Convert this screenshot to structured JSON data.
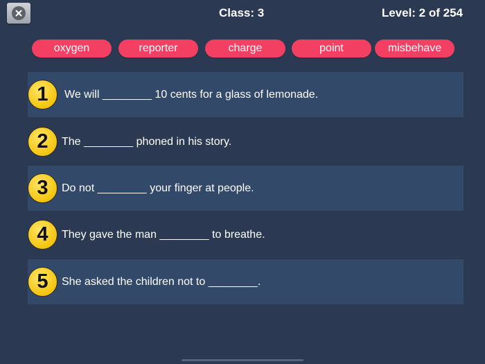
{
  "header": {
    "class_label": "Class: 3",
    "level_label": "Level: 2 of 254"
  },
  "word_bank": [
    "oxygen",
    "reporter",
    "charge",
    "point",
    "misbehave"
  ],
  "questions": [
    {
      "number": "1",
      "text": "We will ________ 10 cents for a glass of lemonade."
    },
    {
      "number": "2",
      "text": "The ________ phoned in his story."
    },
    {
      "number": "3",
      "text": "Do not ________ your finger at people."
    },
    {
      "number": "4",
      "text": "They gave the man ________ to breathe."
    },
    {
      "number": "5",
      "text": "She asked the children not to ________."
    }
  ],
  "colors": {
    "background": "#2b3a52",
    "row_shaded": "#33496a",
    "chip": "#f23f62",
    "badge": "#f4c40e"
  },
  "icons": {
    "close": "close-icon"
  }
}
